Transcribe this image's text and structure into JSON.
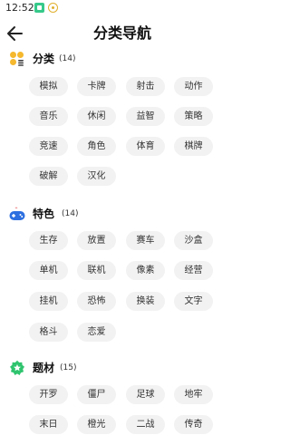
{
  "status_bar": {
    "time": "12:52"
  },
  "header": {
    "title": "分类导航"
  },
  "sections": [
    {
      "title": "分类",
      "count": "(14)",
      "tags": [
        "模拟",
        "卡牌",
        "射击",
        "动作",
        "音乐",
        "休闲",
        "益智",
        "策略",
        "竞速",
        "角色",
        "体育",
        "棋牌",
        "破解",
        "汉化"
      ]
    },
    {
      "title": "特色",
      "count": "(14)",
      "tags": [
        "生存",
        "放置",
        "赛车",
        "沙盒",
        "单机",
        "联机",
        "像素",
        "经营",
        "挂机",
        "恐怖",
        "换装",
        "文字",
        "格斗",
        "恋爱"
      ]
    },
    {
      "title": "题材",
      "count": "(15)",
      "tags": [
        "开罗",
        "僵尸",
        "足球",
        "地牢",
        "末日",
        "橙光",
        "二战",
        "传奇"
      ]
    }
  ],
  "colors": {
    "tag_bg": "#f2f2f2",
    "section1_icon": "#f5b82e",
    "section2_icon": "#2d6fe0",
    "section3_icon": "#2fc46e"
  }
}
